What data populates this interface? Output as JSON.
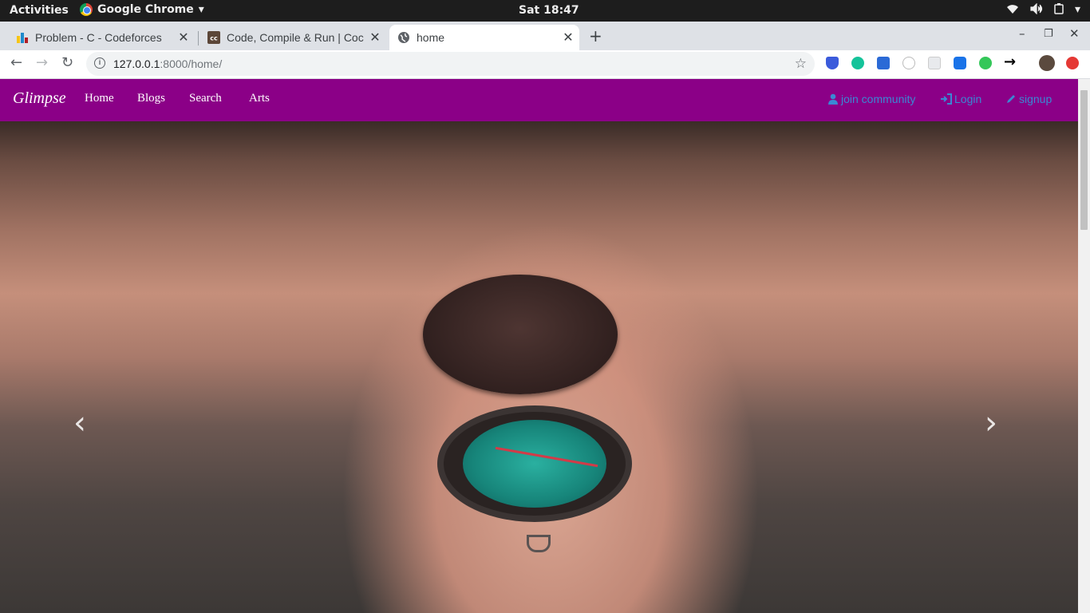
{
  "system_bar": {
    "activities": "Activities",
    "app_name": "Google Chrome",
    "clock": "Sat 18:47"
  },
  "tabs": [
    {
      "title": "Problem - C - Codeforces",
      "favicon": "codeforces-icon",
      "active": false
    },
    {
      "title": "Code, Compile & Run | Coc",
      "favicon": "codechef-icon",
      "active": false
    },
    {
      "title": "home",
      "favicon": "globe-icon",
      "active": true
    }
  ],
  "omnibox": {
    "host": "127.0.0.1",
    "port_path": ":8000/home/"
  },
  "site": {
    "brand": "Glimpse",
    "nav": [
      "Home",
      "Blogs",
      "Search",
      "Arts"
    ],
    "right_links": [
      {
        "label": "join community",
        "icon": "user-icon"
      },
      {
        "label": "Login",
        "icon": "login-icon"
      },
      {
        "label": "signup",
        "icon": "pencil-icon"
      }
    ],
    "link_color": "#3a88d4",
    "navbar_color": "#8b0087"
  },
  "carousel": {
    "slide_count": 6,
    "active_index": 0,
    "prev_icon": "chevron-left-icon",
    "next_icon": "chevron-right-icon",
    "image": "hand-holding-compass"
  }
}
